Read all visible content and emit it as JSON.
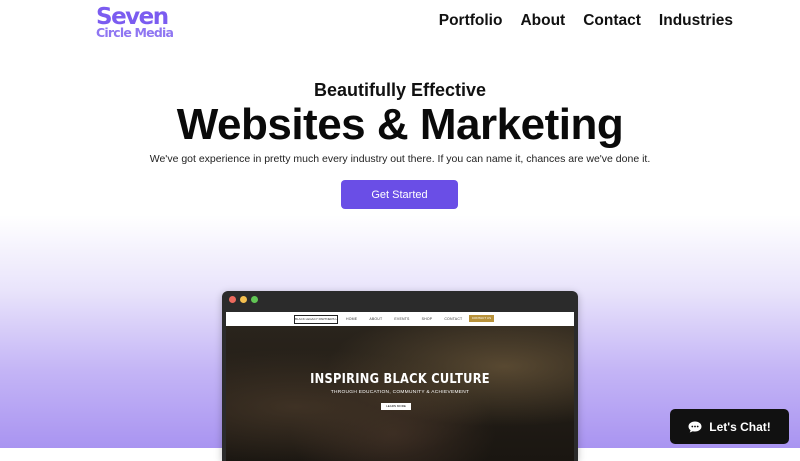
{
  "header": {
    "logo_line1": "Seven",
    "logo_line2": "Circle Media",
    "nav": [
      "Portfolio",
      "About",
      "Contact",
      "Industries"
    ]
  },
  "hero": {
    "subtitle": "Beautifully Effective",
    "title": "Websites & Marketing",
    "description": "We've got experience in pretty much every industry out there. If you can name it, chances are we've done it.",
    "cta_label": "Get Started"
  },
  "preview": {
    "site_logo": "BLACK LEGACY PARTNERS LLC",
    "site_nav": [
      "HOME",
      "ABOUT",
      "EVENTS",
      "SHOP",
      "CONTACT"
    ],
    "site_contact_button": "CONTACT US",
    "headline": "INSPIRING BLACK CULTURE",
    "subheadline": "THROUGH EDUCATION, COMMUNITY & ACHIEVEMENT",
    "button": "LEARN MORE"
  },
  "chat": {
    "label": "Let's Chat!"
  },
  "colors": {
    "accent": "#6a4ee6",
    "logo": "#7b5cf0",
    "gradient_bottom": "#a994f1"
  }
}
